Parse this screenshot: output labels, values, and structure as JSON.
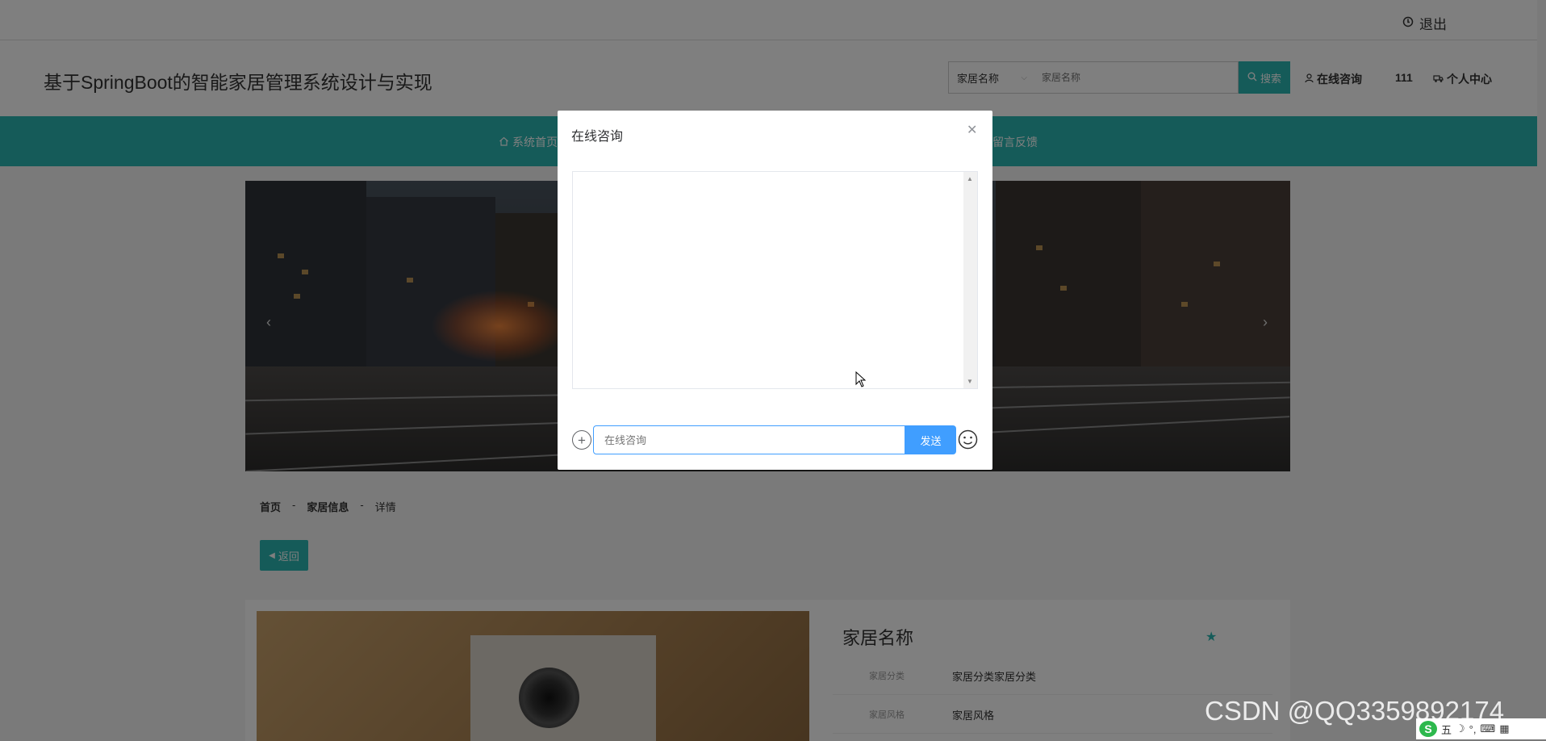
{
  "topbar": {
    "logout_label": "退出"
  },
  "header": {
    "site_title": "基于SpringBoot的智能家居管理系统设计与实现",
    "search_select": "家居名称",
    "search_placeholder": "家居名称",
    "search_button": "搜索",
    "consult_link": "在线咨询",
    "username": "111",
    "personal_center": "个人中心"
  },
  "nav": {
    "items": [
      {
        "label": "系统首页"
      },
      {
        "label": "留言反馈"
      }
    ]
  },
  "breadcrumb": {
    "items": [
      "首页",
      "-",
      "家居信息",
      "-",
      "详情"
    ]
  },
  "back_button": "返回",
  "product": {
    "title": "家居名称",
    "attrs": [
      {
        "label": "家居分类",
        "value": "家居分类家居分类"
      },
      {
        "label": "家居风格",
        "value": "家居风格"
      }
    ]
  },
  "dialog": {
    "title": "在线咨询",
    "input_placeholder": "在线咨询",
    "send_label": "发送"
  },
  "watermark": "CSDN @QQ3359892174",
  "ime": {
    "mode_label": "五"
  },
  "colors": {
    "accent": "#2ab7b2",
    "primary_blue": "#409eff"
  }
}
